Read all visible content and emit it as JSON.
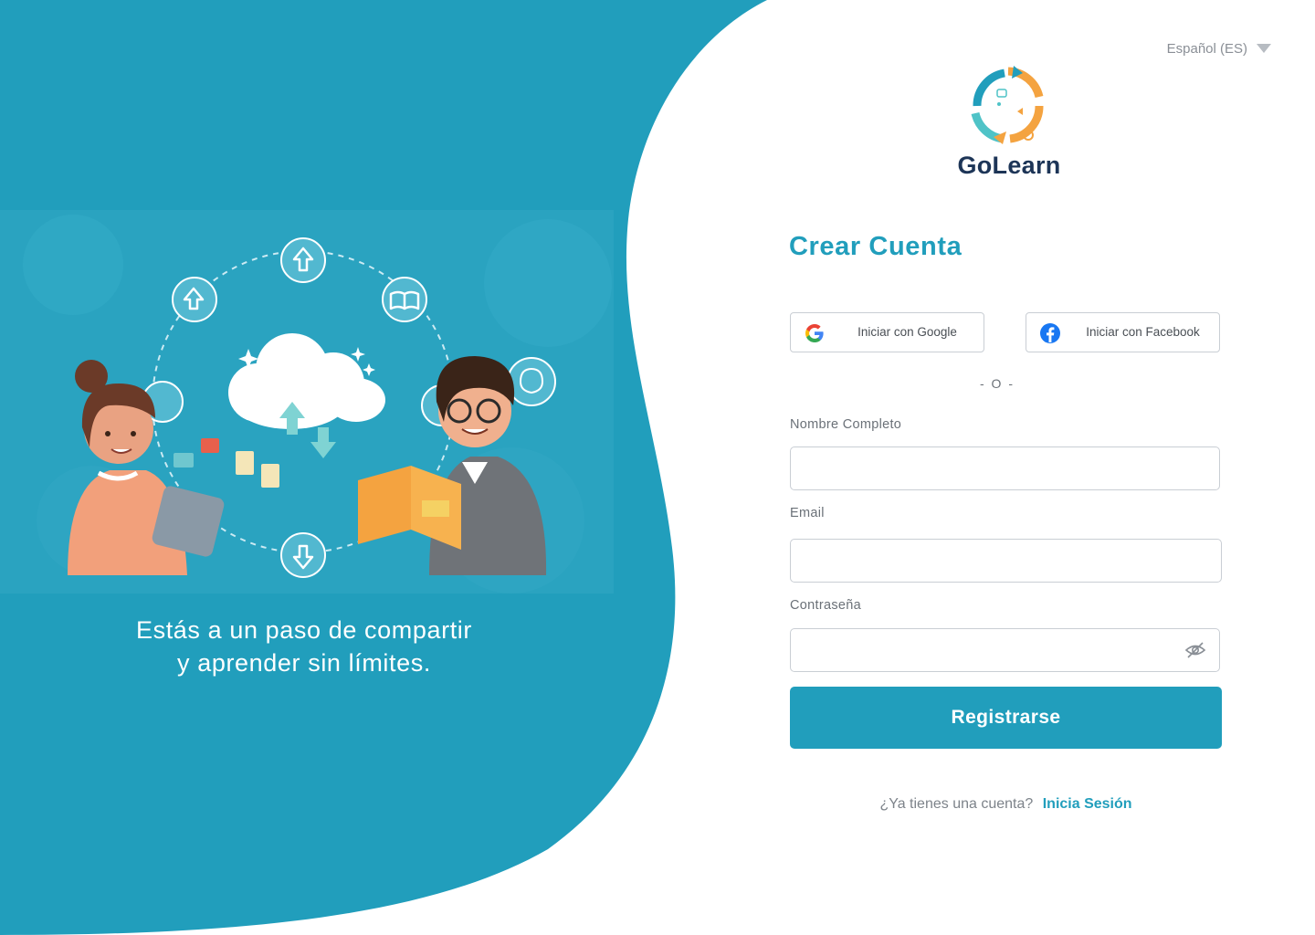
{
  "language": {
    "selected": "Español (ES)"
  },
  "brand": {
    "name": "GoLearn"
  },
  "hero": {
    "tagline_line1": "Estás a un paso de compartir",
    "tagline_line2": "y aprender sin límites."
  },
  "form": {
    "title": "Crear Cuenta",
    "google_label": "Iniciar con Google",
    "facebook_label": "Iniciar con Facebook",
    "divider": "- O -",
    "fullname_label": "Nombre Completo",
    "fullname_value": "",
    "email_label": "Email",
    "email_value": "",
    "password_label": "Contraseña",
    "password_value": "",
    "submit_label": "Registrarse",
    "have_account_text": "¿Ya tienes una cuenta?",
    "signin_link": "Inicia Sesión"
  },
  "colors": {
    "primary": "#219ebc",
    "brand_dark": "#1d3557",
    "accent_orange": "#f4a340",
    "field_border": "#c9ced4"
  },
  "icons": [
    "caret-down-icon",
    "golearn-logo",
    "google-icon",
    "facebook-icon",
    "eye-off-icon"
  ]
}
